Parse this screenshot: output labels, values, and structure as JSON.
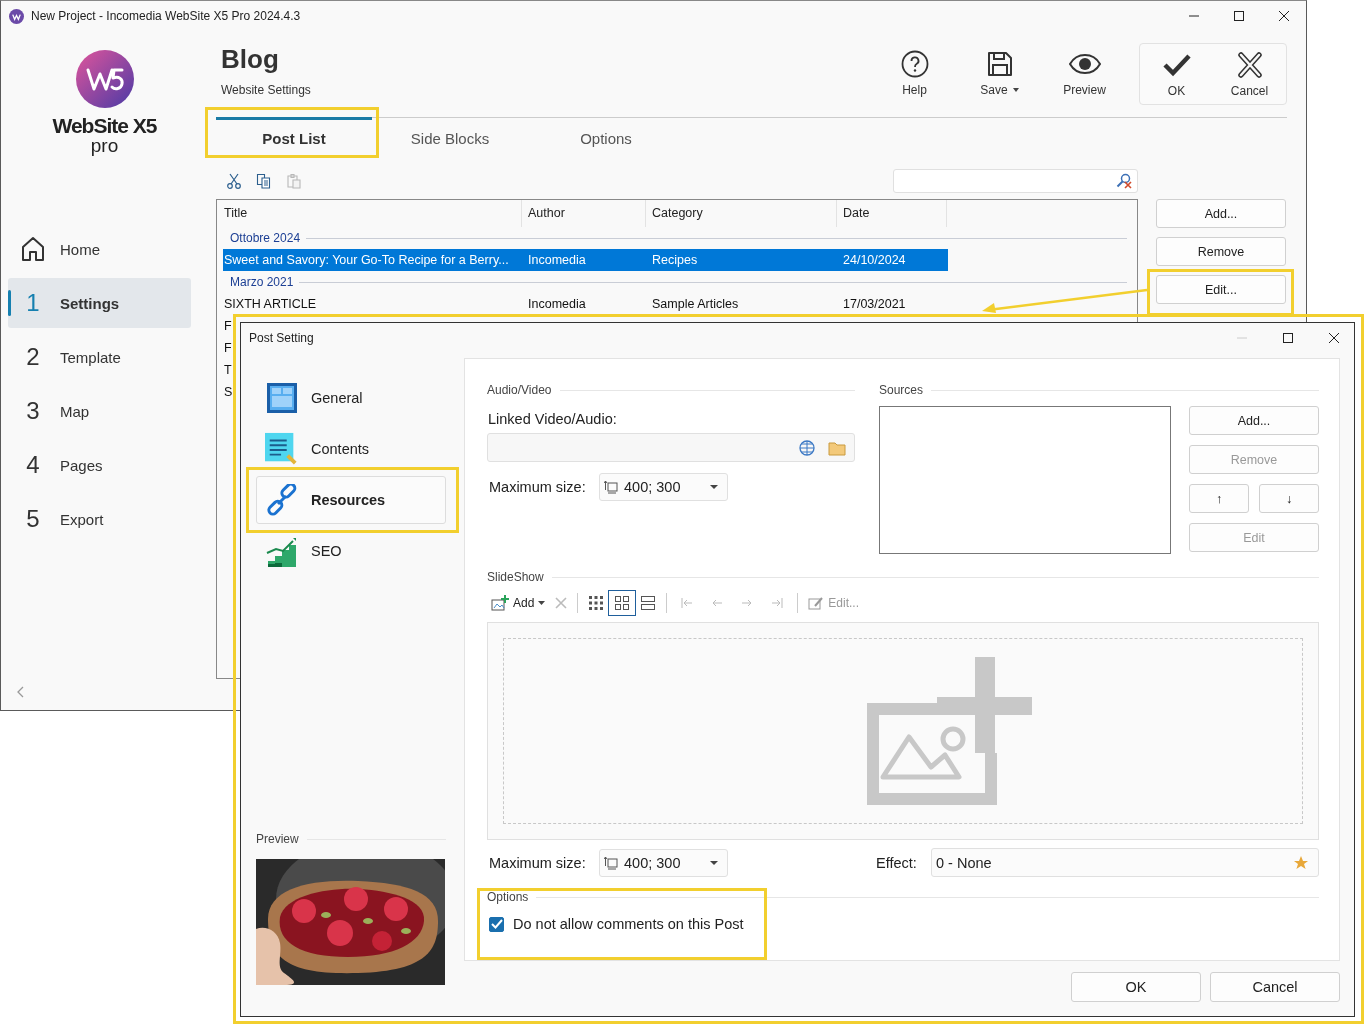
{
  "main_window": {
    "title": "New Project - Incomedia WebSite X5 Pro 2024.4.3",
    "brand": {
      "name": "WebSite X5",
      "edition": "pro"
    },
    "nav": [
      {
        "kind": "home",
        "label": "Home",
        "selected": false
      },
      {
        "kind": "step",
        "number": "1",
        "label": "Settings",
        "selected": true
      },
      {
        "kind": "step",
        "number": "2",
        "label": "Template",
        "selected": false
      },
      {
        "kind": "step",
        "number": "3",
        "label": "Map",
        "selected": false
      },
      {
        "kind": "step",
        "number": "4",
        "label": "Pages",
        "selected": false
      },
      {
        "kind": "step",
        "number": "5",
        "label": "Export",
        "selected": false
      }
    ],
    "header": {
      "title": "Blog",
      "subtitle": "Website Settings"
    },
    "toolbar": [
      {
        "kind": "help",
        "label": "Help",
        "dropdown": false
      },
      {
        "kind": "save",
        "label": "Save",
        "dropdown": true
      },
      {
        "kind": "preview",
        "label": "Preview",
        "dropdown": false
      }
    ],
    "actions": [
      {
        "kind": "ok",
        "label": "OK"
      },
      {
        "kind": "cancel",
        "label": "Cancel"
      }
    ],
    "tabs": [
      {
        "label": "Post List",
        "selected": true
      },
      {
        "label": "Side Blocks",
        "selected": false
      },
      {
        "label": "Options",
        "selected": false
      }
    ],
    "edit_tools": [
      {
        "kind": "cut",
        "disabled": false
      },
      {
        "kind": "copy",
        "disabled": false
      },
      {
        "kind": "paste",
        "disabled": true
      }
    ],
    "table": {
      "columns": [
        "Title",
        "Author",
        "Category",
        "Date"
      ],
      "groups": [
        {
          "label": "Ottobre 2024",
          "rows": [
            {
              "cells": [
                "Sweet and Savory: Your Go-To Recipe for a Berry...",
                "Incomedia",
                "Recipes",
                "24/10/2024"
              ],
              "selected": true
            }
          ]
        },
        {
          "label": "Marzo 2021",
          "rows": [
            {
              "cells": [
                "SIXTH ARTICLE",
                "Incomedia",
                "Sample Articles",
                "17/03/2021"
              ],
              "selected": false
            },
            {
              "cells": [
                "F"
              ],
              "selected": false
            },
            {
              "cells": [
                "F"
              ],
              "selected": false
            },
            {
              "cells": [
                "T"
              ],
              "selected": false
            },
            {
              "cells": [
                "S"
              ],
              "selected": false
            }
          ]
        }
      ]
    },
    "side_buttons": [
      {
        "label": "Add..."
      },
      {
        "label": "Remove"
      },
      {
        "label": "Edit..."
      }
    ]
  },
  "post_setting": {
    "title": "Post Setting",
    "nav": [
      {
        "kind": "general",
        "label": "General",
        "selected": false
      },
      {
        "kind": "contents",
        "label": "Contents",
        "selected": false
      },
      {
        "kind": "resources",
        "label": "Resources",
        "selected": true
      },
      {
        "kind": "seo",
        "label": "SEO",
        "selected": false
      }
    ],
    "preview_label": "Preview",
    "audio_video": {
      "heading": "Audio/Video",
      "linked_label": "Linked Video/Audio:",
      "max_size_label": "Maximum size:",
      "max_size": "400; 300"
    },
    "sources": {
      "heading": "Sources",
      "buttons": [
        {
          "kind": "wide",
          "label": "Add...",
          "disabled": false
        },
        {
          "kind": "wide",
          "label": "Remove",
          "disabled": true
        },
        {
          "kind": "half",
          "label": "↑",
          "disabled": false
        },
        {
          "kind": "half",
          "label": "↓",
          "disabled": false
        },
        {
          "kind": "wide",
          "label": "Edit",
          "disabled": true
        }
      ]
    },
    "slideshow": {
      "heading": "SlideShow",
      "tools": [
        {
          "kind": "add",
          "label": "Add",
          "dropdown": true,
          "disabled": false
        },
        {
          "kind": "delete",
          "disabled": true
        }
      ],
      "views": [
        {
          "kind": "small-grid",
          "selected": false
        },
        {
          "kind": "large-grid",
          "selected": true
        },
        {
          "kind": "list",
          "selected": false
        }
      ],
      "navigation": [
        {
          "kind": "first",
          "disabled": true
        },
        {
          "kind": "prev",
          "disabled": true
        },
        {
          "kind": "next",
          "disabled": true
        },
        {
          "kind": "last",
          "disabled": true
        }
      ],
      "edit": {
        "label": "Edit...",
        "disabled": true
      },
      "max_size_label": "Maximum size:",
      "max_size": "400; 300",
      "effect_label": "Effect:",
      "effect": "0 - None"
    },
    "options": {
      "heading": "Options",
      "checkbox": {
        "label": "Do not allow comments on this Post",
        "checked": true
      }
    },
    "buttons": [
      {
        "label": "OK"
      },
      {
        "label": "Cancel"
      }
    ]
  }
}
